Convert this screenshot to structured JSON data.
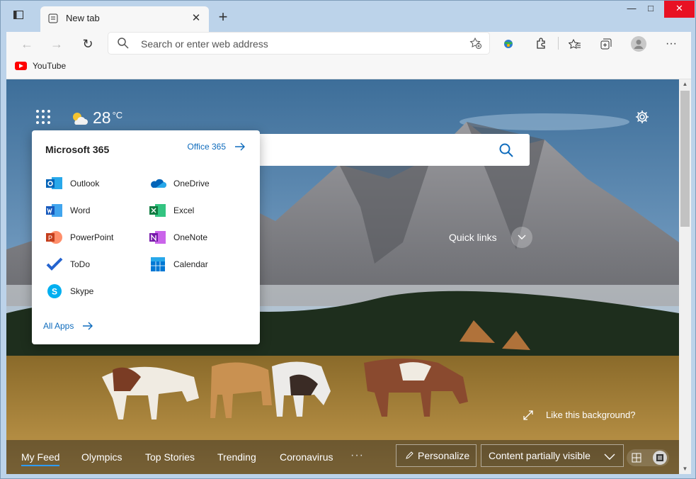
{
  "window": {
    "minimize": "—",
    "maximize": "□",
    "close": "✕"
  },
  "tab": {
    "title": "New tab"
  },
  "toolbar": {
    "address_placeholder": "Search or enter web address"
  },
  "bookmarks": [
    {
      "label": "YouTube"
    }
  ],
  "weather": {
    "temperature": "28",
    "unit": "°C"
  },
  "m365_panel": {
    "title": "Microsoft 365",
    "office_link": "Office 365",
    "apps_left": [
      "Outlook",
      "Word",
      "PowerPoint",
      "ToDo",
      "Skype"
    ],
    "apps_right": [
      "OneDrive",
      "Excel",
      "OneNote",
      "Calendar"
    ],
    "all_apps": "All Apps"
  },
  "quick_links": "Quick links",
  "like_background": "Like this background?",
  "feed": {
    "tabs": [
      "My Feed",
      "Olympics",
      "Top Stories",
      "Trending",
      "Coronavirus"
    ],
    "more": "···",
    "personalize": "Personalize",
    "visibility": "Content partially visible"
  },
  "colors": {
    "accent": "#0f6cbd",
    "titlebar": "#bcd3ea",
    "close": "#e81123"
  }
}
